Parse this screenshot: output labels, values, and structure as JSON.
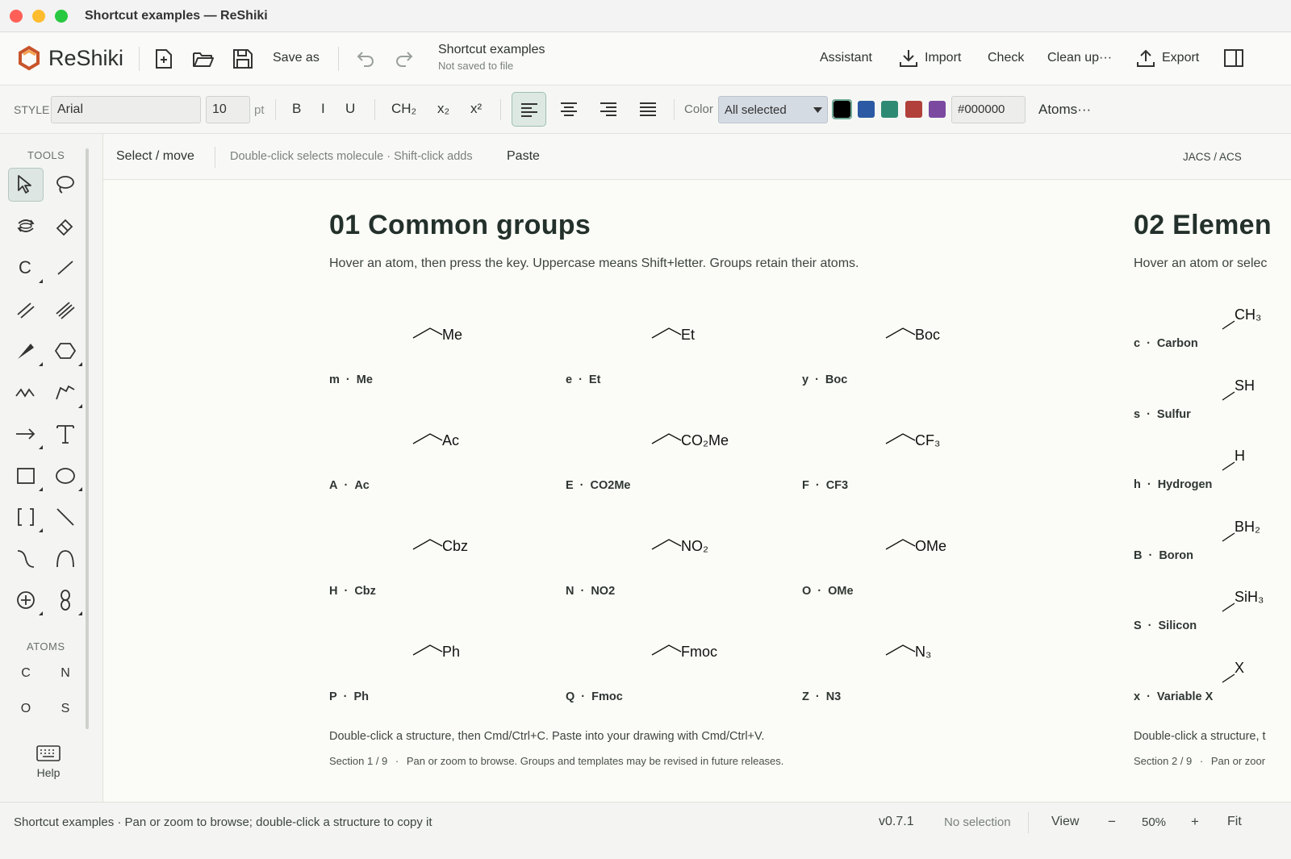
{
  "window": {
    "title": "Shortcut examples — ReShiki"
  },
  "app": {
    "name": "ReShiki"
  },
  "header": {
    "save_as": "Save as",
    "doc_title": "Shortcut examples",
    "doc_status": "Not saved to file",
    "assistant": "Assistant",
    "import": "Import",
    "check": "Check",
    "cleanup": "Clean up···",
    "export": "Export"
  },
  "style_toolbar": {
    "label": "STYLE",
    "font": "Arial",
    "size": "10",
    "unit": "pt",
    "bold": "B",
    "italic": "I",
    "underline": "U",
    "ch2": "CH₂",
    "subscript": "x₂",
    "superscript": "x²",
    "color_label": "Color",
    "color_select": "All selected",
    "hex": "#000000",
    "atoms": "Atoms···",
    "swatches": [
      "#000000",
      "#2b59a3",
      "#2f8a74",
      "#b2413b",
      "#7b4aa0"
    ]
  },
  "sidebar": {
    "tools_label": "TOOLS",
    "atoms_label": "ATOMS",
    "atoms": [
      "C",
      "N",
      "O",
      "S"
    ],
    "help": "Help",
    "tool_icons": [
      "select-arrow-icon",
      "lasso-icon",
      "rotate-icon",
      "eraser-icon",
      "carbon-chain-icon",
      "single-bond-icon",
      "double-bond-icon",
      "triple-bond-icon",
      "wedge-bond-icon",
      "hexagon-ring-icon",
      "zigzag-chain-icon",
      "freehand-chain-icon",
      "arrow-icon",
      "text-icon",
      "rectangle-icon",
      "ellipse-icon",
      "bracket-icon",
      "line-icon",
      "curve-icon",
      "arc-icon",
      "charge-plus-icon",
      "orbital-icon"
    ]
  },
  "modebar": {
    "mode": "Select / move",
    "hint": "Double-click selects molecule · Shift-click adds",
    "paste": "Paste",
    "style_preset": "JACS / ACS"
  },
  "sections": [
    {
      "title": "01  Common groups",
      "subtitle": "Hover an atom, then press the key. Uppercase means Shift+letter. Groups retain their atoms.",
      "footer": "Double-click a structure, then Cmd/Ctrl+C. Paste into your drawing with Cmd/Ctrl+V.",
      "meta_section": "Section 1 / 9",
      "meta_text": "Pan or zoom to browse. Groups and templates may be revised in future releases.",
      "groups": [
        {
          "key": "m",
          "name": "Me",
          "label": "Me"
        },
        {
          "key": "e",
          "name": "Et",
          "label": "Et"
        },
        {
          "key": "y",
          "name": "Boc",
          "label": "Boc"
        },
        {
          "key": "A",
          "name": "Ac",
          "label": "Ac"
        },
        {
          "key": "E",
          "name": "CO2Me",
          "label": "CO₂Me"
        },
        {
          "key": "F",
          "name": "CF3",
          "label": "CF₃"
        },
        {
          "key": "H",
          "name": "Cbz",
          "label": "Cbz"
        },
        {
          "key": "N",
          "name": "NO2",
          "label": "NO₂"
        },
        {
          "key": "O",
          "name": "OMe",
          "label": "OMe"
        },
        {
          "key": "P",
          "name": "Ph",
          "label": "Ph"
        },
        {
          "key": "Q",
          "name": "Fmoc",
          "label": "Fmoc"
        },
        {
          "key": "Z",
          "name": "N3",
          "label": "N₃"
        }
      ]
    },
    {
      "title": "02  Elemen",
      "subtitle": "Hover an atom or selec",
      "footer": "Double-click a structure, t",
      "meta_section": "Section 2 / 9",
      "meta_text": "Pan or zoor",
      "groups": [
        {
          "key": "c",
          "name": "Carbon",
          "label": "CH₃"
        },
        {
          "key": "s",
          "name": "Sulfur",
          "label": "SH"
        },
        {
          "key": "h",
          "name": "Hydrogen",
          "label": "H"
        },
        {
          "key": "B",
          "name": "Boron",
          "label": "BH₂"
        },
        {
          "key": "S",
          "name": "Silicon",
          "label": "SiH₃"
        },
        {
          "key": "x",
          "name": "Variable X",
          "label": "X"
        }
      ]
    }
  ],
  "statusbar": {
    "message": "Shortcut examples · Pan or zoom to browse; double-click a structure to copy it",
    "version": "v0.7.1",
    "selection": "No selection",
    "view": "View",
    "zoom_out": "−",
    "zoom": "50%",
    "zoom_in": "+",
    "fit": "Fit"
  }
}
